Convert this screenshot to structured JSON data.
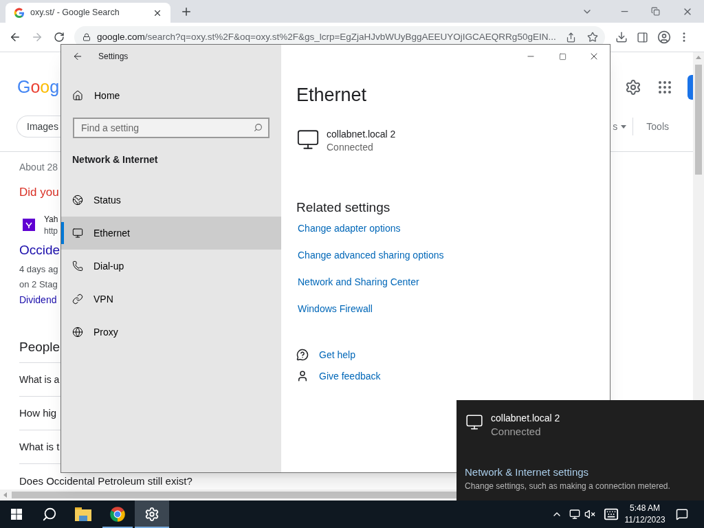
{
  "browser": {
    "tab": {
      "title": "oxy.st/ - Google Search",
      "selected": true
    },
    "address": {
      "host": "google.com",
      "path": "/search?q=oxy.st%2F&oq=oxy.st%2F&gs_lcrp=EgZjaHJvbWUyBggAEEUYOjIGCAEQRRg50gEIN..."
    },
    "page": {
      "logo": "Goog",
      "chip": "Images",
      "filter_fragment": "s",
      "tools": "Tools",
      "results_count": "About 28",
      "did_you_mean": "Did you",
      "result": {
        "source": "Yah",
        "url": "http",
        "title": "Occide",
        "snippet": [
          "4 days ag",
          "on 2 Stag"
        ],
        "link": "Dividend"
      },
      "people_also_ask": {
        "heading": "People",
        "questions": [
          "What is a",
          "How hig",
          "What is t",
          "Does Occidental Petroleum still exist?"
        ]
      }
    }
  },
  "settings": {
    "title": "Settings",
    "home": "Home",
    "search": {
      "placeholder": "Find a setting"
    },
    "section": "Network & Internet",
    "nav": [
      {
        "kind": "status",
        "label": "Status",
        "selected": false
      },
      {
        "kind": "ethernet",
        "label": "Ethernet",
        "selected": true
      },
      {
        "kind": "dialup",
        "label": "Dial-up",
        "selected": false
      },
      {
        "kind": "vpn",
        "label": "VPN",
        "selected": false
      },
      {
        "kind": "proxy",
        "label": "Proxy",
        "selected": false
      }
    ],
    "heading": "Ethernet",
    "network": {
      "name": "collabnet.local 2",
      "status": "Connected"
    },
    "related": {
      "heading": "Related settings",
      "links": [
        "Change adapter options",
        "Change advanced sharing options",
        "Network and Sharing Center",
        "Windows Firewall"
      ]
    },
    "help": [
      {
        "kind": "help",
        "label": "Get help"
      },
      {
        "kind": "feedback",
        "label": "Give feedback"
      }
    ]
  },
  "flyout": {
    "network": {
      "name": "collabnet.local 2",
      "status": "Connected"
    },
    "link": "Network & Internet settings",
    "description": "Change settings, such as making a connection metered."
  },
  "taskbar": {
    "apps": [
      {
        "kind": "explorer",
        "running": false,
        "selected": false
      },
      {
        "kind": "chrome",
        "running": true,
        "selected": false
      },
      {
        "kind": "settings",
        "running": true,
        "selected": true
      }
    ],
    "time": "5:48 AM",
    "date": "11/12/2023"
  }
}
